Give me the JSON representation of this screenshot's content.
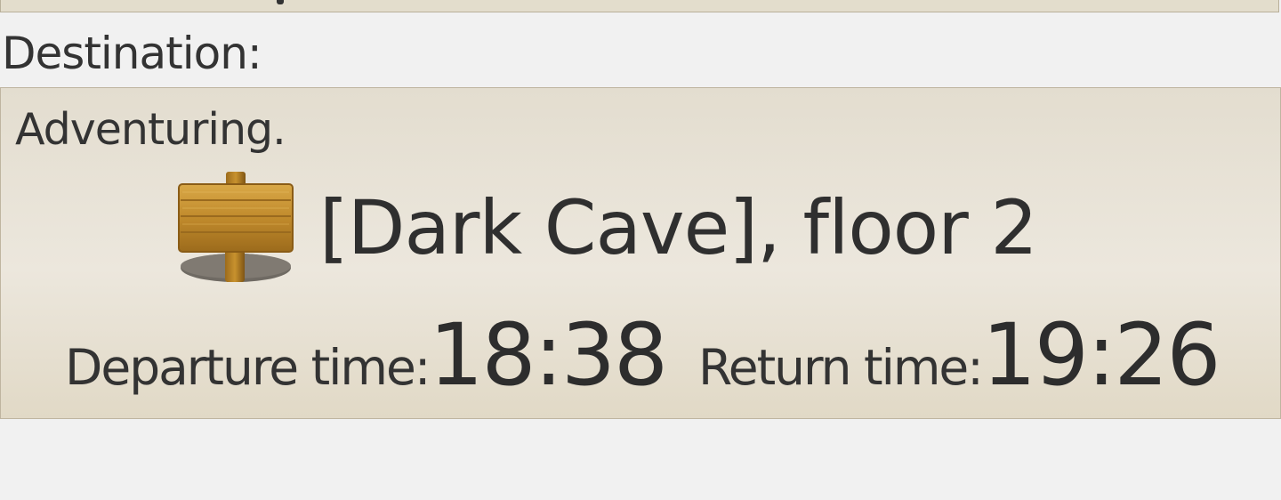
{
  "destination_label": "Destination:",
  "status": "Adventuring.",
  "location": {
    "icon": "signpost-icon",
    "name": "[Dark Cave], floor 2"
  },
  "departure": {
    "label": "Departure time:",
    "value": "18:38"
  },
  "return": {
    "label": "Return time:",
    "value": "19:26"
  },
  "colors": {
    "background": "#f1f1f1",
    "panel": "#e3ddcf",
    "panel_border": "#bfb5a0",
    "text": "#333333",
    "sign_wood": "#c8922e"
  }
}
